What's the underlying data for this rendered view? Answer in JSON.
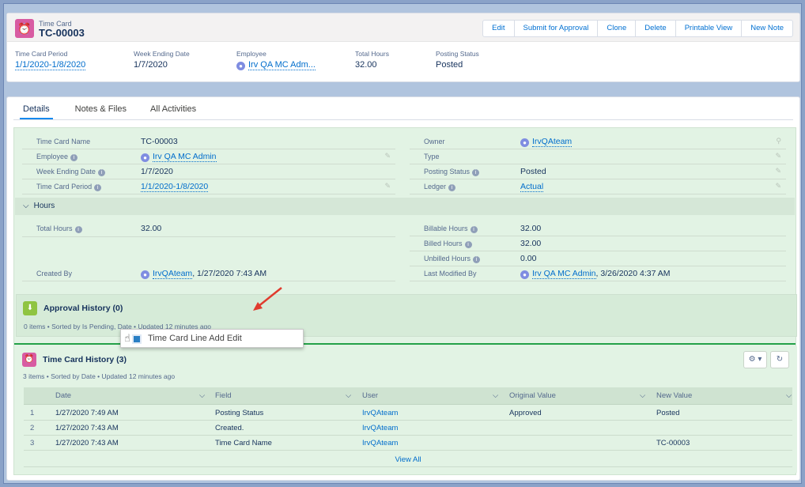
{
  "header": {
    "object_label": "Time Card",
    "record_title": "TC-00003",
    "buttons": [
      "Edit",
      "Submit for Approval",
      "Clone",
      "Delete",
      "Printable View",
      "New Note"
    ],
    "highlights": [
      {
        "label": "Time Card Period",
        "value": "1/1/2020-1/8/2020"
      },
      {
        "label": "Week Ending Date",
        "value": "1/7/2020"
      },
      {
        "label": "Employee",
        "value": "Irv QA MC Adm..."
      },
      {
        "label": "Total Hours",
        "value": "32.00"
      },
      {
        "label": "Posting Status",
        "value": "Posted"
      }
    ]
  },
  "tabs": [
    "Details",
    "Notes & Files",
    "All Activities"
  ],
  "details": {
    "left": [
      {
        "label": "Time Card Name",
        "value": "TC-00003"
      },
      {
        "label": "Employee",
        "value": "Irv QA MC Admin"
      },
      {
        "label": "Week Ending Date",
        "value": "1/7/2020"
      },
      {
        "label": "Time Card Period",
        "value": "1/1/2020-1/8/2020"
      }
    ],
    "right": [
      {
        "label": "Owner",
        "value": "IrvQAteam"
      },
      {
        "label": "Type",
        "value": ""
      },
      {
        "label": "Posting Status",
        "value": "Posted"
      },
      {
        "label": "Ledger",
        "value": "Actual"
      }
    ],
    "hours_section": "Hours",
    "hours_left": [
      {
        "label": "Total Hours",
        "value": "32.00"
      }
    ],
    "hours_right": [
      {
        "label": "Billable Hours",
        "value": "32.00"
      },
      {
        "label": "Billed Hours",
        "value": "32.00"
      },
      {
        "label": "Unbilled Hours",
        "value": "0.00"
      }
    ],
    "created_by_label": "Created By",
    "created_by_user": "IrvQAteam",
    "created_by_date": ", 1/27/2020 7:43 AM",
    "modified_by_label": "Last Modified By",
    "modified_by_user": "Irv QA MC Admin",
    "modified_by_date": ", 3/26/2020 4:37 AM"
  },
  "approval_history": {
    "title": "Approval History (0)",
    "subtitle": "0 items • Sorted by Is Pending, Date • Updated 12 minutes ago"
  },
  "popup": {
    "label": "Time Card Line Add Edit"
  },
  "history": {
    "title": "Time Card History (3)",
    "subtitle": "3 items • Sorted by Date • Updated 12 minutes ago",
    "columns": [
      "Date",
      "Field",
      "User",
      "Original Value",
      "New Value"
    ],
    "rows": [
      {
        "num": "1",
        "date": "1/27/2020 7:49 AM",
        "field": "Posting Status",
        "user": "IrvQAteam",
        "orig": "Approved",
        "new": "Posted"
      },
      {
        "num": "2",
        "date": "1/27/2020 7:43 AM",
        "field": "Created.",
        "user": "IrvQAteam",
        "orig": "",
        "new": ""
      },
      {
        "num": "3",
        "date": "1/27/2020 7:43 AM",
        "field": "Time Card Name",
        "user": "IrvQAteam",
        "orig": "",
        "new": "TC-00003"
      }
    ],
    "view_all": "View All"
  },
  "colors": {
    "accent": "#0070d2",
    "record_icon": "#d85ba2",
    "approval_icon": "#8fc441",
    "panel_green": "#e2f3e4",
    "arrow_red": "#e03b2e"
  },
  "icons": {
    "record": "alarm-clock-icon",
    "approval": "approval-icon",
    "user": "user-avatar-icon",
    "info": "info-icon",
    "pencil": "pencil-icon",
    "settings": "gear-icon",
    "refresh": "refresh-icon"
  }
}
